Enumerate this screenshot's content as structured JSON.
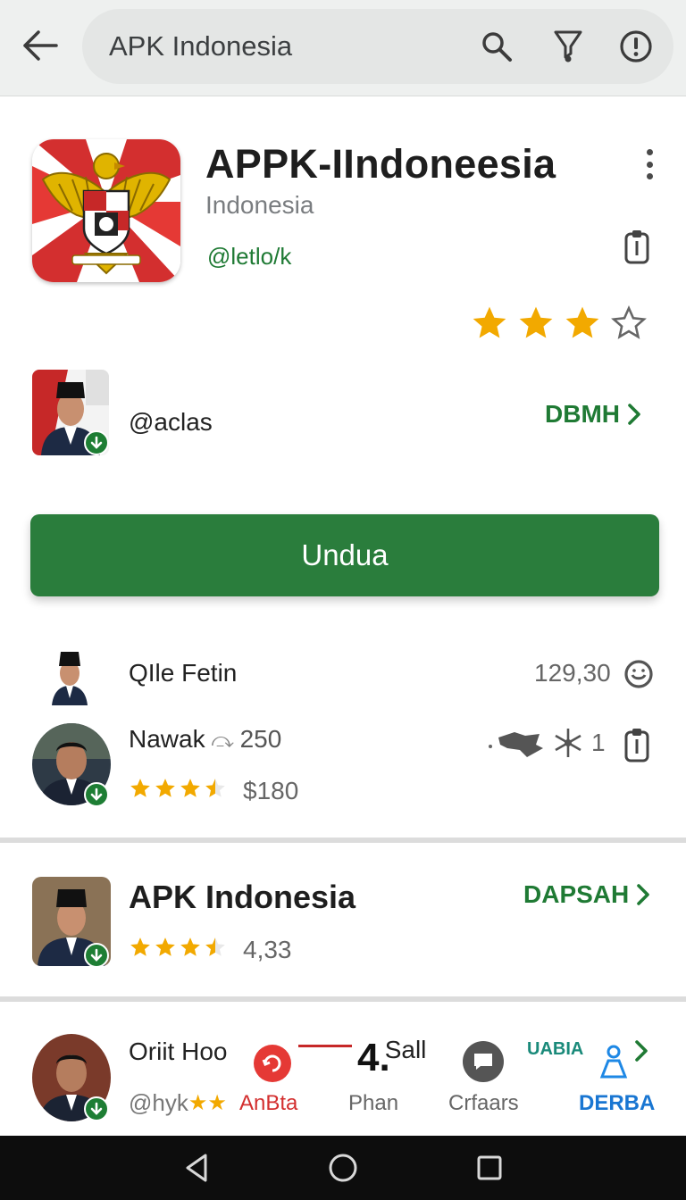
{
  "search": {
    "query": "APK Indonesia",
    "back_icon": "arrow-left-icon",
    "search_icon": "search-icon",
    "filter_icon": "filter-icon",
    "info_icon": "info-icon"
  },
  "app": {
    "title": "APPK-IIndoneesia",
    "subtitle": "Indonesia",
    "developer": "@letlo/k",
    "rating_stars": 3,
    "rating_max": 4
  },
  "developer_row": {
    "handle": "@aclas",
    "link_label": "DBMH"
  },
  "install_button": {
    "label": "Unduа"
  },
  "list": {
    "row1": {
      "name": "QIle Fetin",
      "value": "129,30"
    },
    "row2": {
      "name": "Nawak",
      "name_suffix": "250",
      "price": "$180",
      "right_count": "1",
      "stars": 3.5
    }
  },
  "card2": {
    "title": "APK Indonesia",
    "link_label": "DAPSAH",
    "rating": "4,33",
    "stars": 3.5
  },
  "bottom_row": {
    "name": "Oriit Hoo",
    "handle": "@hyk",
    "item1_label": "AnBta",
    "item2_top": "4.",
    "item2_top_suffix": "Sall",
    "item2_label": "Phan",
    "item3_label": "Crfaars",
    "item4_top": "UABIA",
    "item4_label": "DERBA"
  },
  "colors": {
    "accent_green": "#2a7d3c",
    "link_green": "#1f7a34",
    "star_gold": "#f2a900",
    "badge_green": "#1e7e34"
  }
}
